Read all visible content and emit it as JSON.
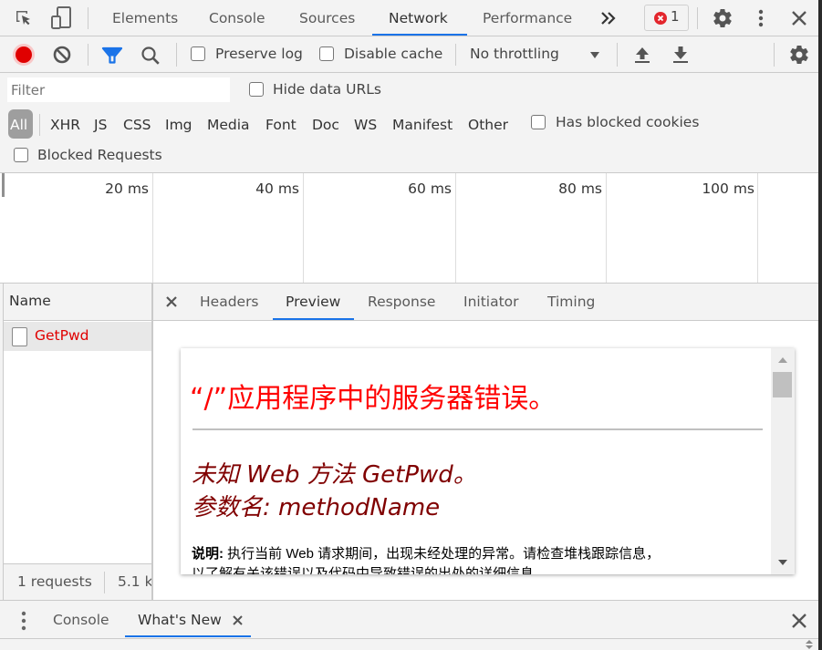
{
  "main_tabs": {
    "items": [
      {
        "label": "Elements"
      },
      {
        "label": "Console"
      },
      {
        "label": "Sources"
      },
      {
        "label": "Network",
        "active": true
      },
      {
        "label": "Performance"
      }
    ],
    "overflow_icon": "double-chevron-right",
    "error_count": "1"
  },
  "network_toolbar": {
    "preserve_log": "Preserve log",
    "disable_cache": "Disable cache",
    "throttling": "No throttling"
  },
  "filter_bar": {
    "filter_placeholder": "Filter",
    "hide_data_urls": "Hide data URLs",
    "types": [
      "All",
      "XHR",
      "JS",
      "CSS",
      "Img",
      "Media",
      "Font",
      "Doc",
      "WS",
      "Manifest",
      "Other"
    ],
    "selected_type": "All",
    "has_blocked_cookies": "Has blocked cookies",
    "blocked_requests": "Blocked Requests"
  },
  "overview": {
    "ticks": [
      "20 ms",
      "40 ms",
      "60 ms",
      "80 ms",
      "100 ms"
    ]
  },
  "request_list": {
    "column_name": "Name",
    "rows": [
      {
        "name": "GetPwd",
        "status": "error"
      }
    ],
    "summary_requests": "1 requests",
    "summary_size": "5.1 k"
  },
  "detail_tabs": {
    "items": [
      {
        "label": "Headers"
      },
      {
        "label": "Preview",
        "active": true
      },
      {
        "label": "Response"
      },
      {
        "label": "Initiator"
      },
      {
        "label": "Timing"
      }
    ]
  },
  "preview": {
    "heading": "“/”应用程序中的服务器错误。",
    "message_line1": "未知 Web 方法 GetPwd。",
    "message_line2": "参数名: methodName",
    "description_label": "说明:",
    "description_text": "执行当前 Web 请求期间，出现未经处理的异常。请检查堆栈跟踪信息，",
    "description_text2": "以了解有关该错误以及代码中导致错误的出处的详细信息。",
    "heading_color": "#ff0000",
    "message_color": "#800000"
  },
  "drawer": {
    "tabs": [
      {
        "label": "Console"
      },
      {
        "label": "What's New",
        "active": true,
        "closable": true
      }
    ]
  },
  "colors": {
    "accent": "#1a73e8",
    "record": "#e00000",
    "error_row": "#e00000",
    "filter_icon": "#1a73e8"
  }
}
